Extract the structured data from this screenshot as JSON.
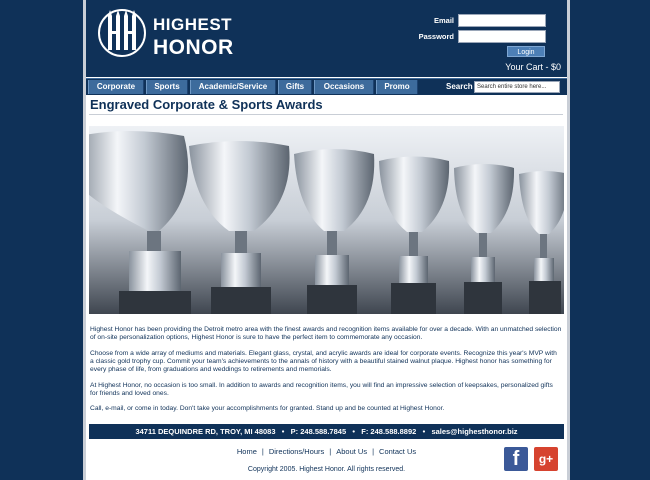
{
  "brand": {
    "line1": "HIGHEST",
    "line2": "HONOR",
    "logo_mark": "HH"
  },
  "login": {
    "email_label": "Email",
    "password_label": "Password",
    "button_label": "Login"
  },
  "cart": {
    "label": "Your Cart - $0"
  },
  "nav": {
    "items": [
      "Corporate",
      "Sports",
      "Academic/Service",
      "Gifts",
      "Occasions",
      "Promo"
    ],
    "search_label": "Search",
    "search_placeholder": "Search entire store here..."
  },
  "page": {
    "title": "Engraved Corporate & Sports Awards"
  },
  "banner": {
    "icon": "trophy-cups-photo"
  },
  "copy": {
    "p1": "Highest Honor has been providing the Detroit metro area with the finest awards and recognition items available for over a decade. With an unmatched selection of on-site personalization options, Highest Honor is sure to have the perfect item to commemorate any occasion.",
    "p2": "Choose from a wide array of mediums and materials. Elegant glass, crystal, and acrylic awards are ideal for corporate events. Recognize this year's MVP with a classic gold trophy cup. Commit your team's achievements to the annals of history with a beautiful stained walnut plaque. Highest honor has something for every phase of life, from graduations and weddings to retirements and memorials.",
    "p3": "At Highest Honor, no occasion is too small. In addition to awards and recognition items, you will find an impressive selection of keepsakes, personalized gifts for friends and loved ones.",
    "p4": "Call, e-mail, or come in today. Don't take your accomplishments for granted. Stand up and be counted at Highest Honor."
  },
  "contact": {
    "address": "34711 DEQUINDRE RD, TROY, MI 48083",
    "phone": "P: 248.588.7845",
    "fax": "F: 248.588.8892",
    "email": "sales@highesthonor.biz"
  },
  "footer": {
    "links": [
      "Home",
      "Directions/Hours",
      "About Us",
      "Contact Us"
    ],
    "copyright": "Copyright 2005. Highest Honor. All rights reserved."
  },
  "social": {
    "facebook": "f",
    "googleplus": "g+"
  },
  "colors": {
    "navy": "#0f3158",
    "nav_tab": "#3d6b9c",
    "facebook": "#3b5998",
    "googleplus": "#d6432f"
  }
}
